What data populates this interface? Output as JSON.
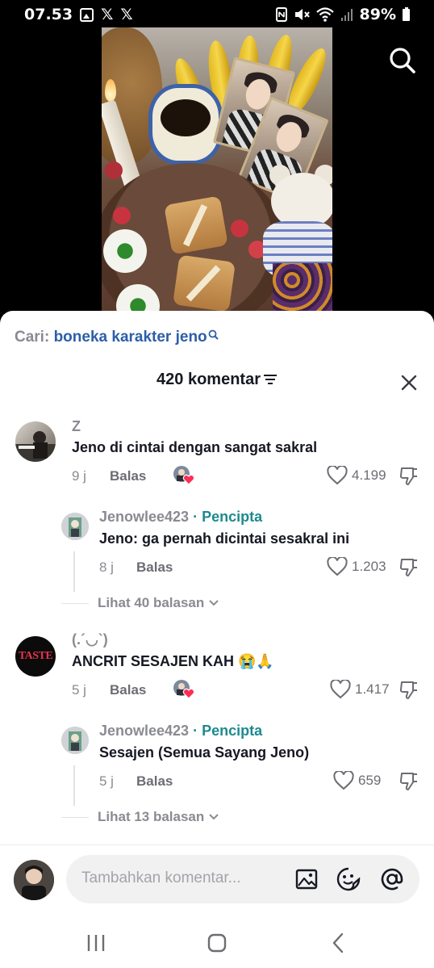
{
  "status_bar": {
    "time": "07.53",
    "battery": "89%",
    "left_icons": [
      "image-icon",
      "x-logo-icon",
      "x-logo-icon"
    ],
    "right_icons": [
      "nfc-icon",
      "mute-icon",
      "wifi-icon",
      "signal-icon",
      "battery-icon"
    ]
  },
  "search": {
    "label": "Cari:",
    "term": "boneka karakter jeno"
  },
  "comments_header": {
    "title": "420 komentar"
  },
  "comments": [
    {
      "username": "Z",
      "text": "Jeno di cintai dengan sangat sakral",
      "time": "9 j",
      "reply_label": "Balas",
      "likes": "4.199",
      "reply": {
        "username": "Jenowlee423",
        "creator_badge": "· Pencipta",
        "text": "Jeno: ga pernah dicintai sesakral ini",
        "time": "8 j",
        "reply_label": "Balas",
        "likes": "1.203"
      },
      "view_replies": "Lihat 40 balasan"
    },
    {
      "username": "(.´◡`)",
      "text": "ANCRIT SESAJEN KAH 😭🙏",
      "time": "5 j",
      "reply_label": "Balas",
      "likes": "1.417",
      "avatar_text": "TASTE",
      "reply": {
        "username": "Jenowlee423",
        "creator_badge": "· Pencipta",
        "text": "Sesajen (Semua Sayang Jeno)",
        "time": "5 j",
        "reply_label": "Balas",
        "likes": "659"
      },
      "view_replies": "Lihat 13 balasan"
    }
  ],
  "composer": {
    "placeholder": "Tambahkan komentar..."
  },
  "colors": {
    "creator": "#1e8a8f",
    "search_term": "#2c5ea8",
    "liked_heart": "#fe2c55"
  }
}
